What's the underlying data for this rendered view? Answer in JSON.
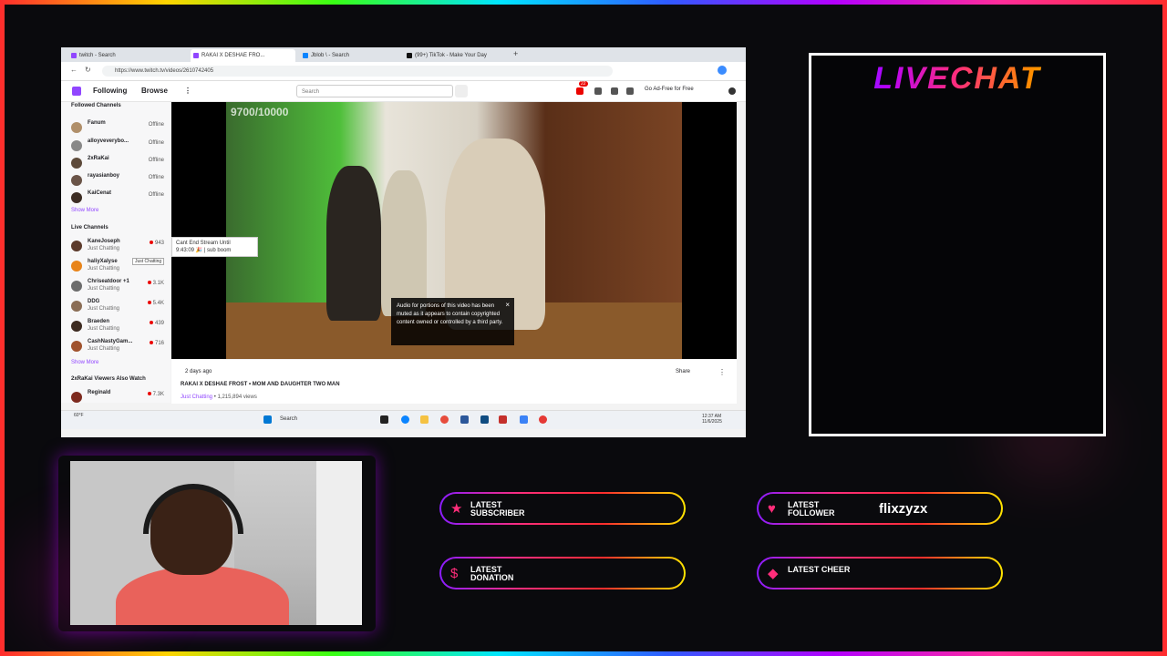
{
  "browser": {
    "tabs": [
      {
        "label": "twitch - Search"
      },
      {
        "label": "RAKAI X DESHAE FRO..."
      },
      {
        "label": "Jblob \\ - Search"
      },
      {
        "label": "(99+) TikTok - Make Your Day"
      }
    ],
    "url": "https://www.twitch.tv/videos/2610742405"
  },
  "twitch": {
    "nav": {
      "following": "Following",
      "browse": "Browse"
    },
    "search_placeholder": "Search",
    "notif_count": "22",
    "ad_free": "Go Ad-Free for Free",
    "sidebar": {
      "followed_title": "Followed Channels",
      "followed": [
        {
          "name": "Fanum",
          "status": "Offline"
        },
        {
          "name": "alloyveverybo...",
          "status": "Offline"
        },
        {
          "name": "2xRaKai",
          "status": "Offline"
        },
        {
          "name": "rayasianboy",
          "status": "Offline"
        },
        {
          "name": "KaiCenat",
          "status": "Offline"
        }
      ],
      "show_more": "Show More",
      "live_title": "Live Channels",
      "live": [
        {
          "name": "KaneJoseph",
          "category": "Just Chatting",
          "viewers": "943"
        },
        {
          "name": "haliyXalyse",
          "category": "Just Chatting",
          "viewers": ""
        },
        {
          "name": "Chriseatdoor +1",
          "category": "Just Chatting",
          "viewers": "3.1K"
        },
        {
          "name": "DDG",
          "category": "Just Chatting",
          "viewers": "5.4K"
        },
        {
          "name": "Braeden",
          "category": "Just Chatting",
          "viewers": "439"
        },
        {
          "name": "CashNastyGam...",
          "category": "Just Chatting",
          "viewers": "716"
        }
      ],
      "also_watch_title": "2xRaKai Viewers Also Watch",
      "also_watch": [
        {
          "name": "Reginald",
          "viewers": "7.3K"
        }
      ],
      "hover_tooltip": "Just Chatting"
    },
    "player": {
      "counter": "9700/10000",
      "mute_notice": "Audio for portions of this video has been muted as it appears to contain copyrighted content owned or controlled by a third party.",
      "tooltip_line1": "Cant End Stream Until",
      "tooltip_line2": "9:43:09 🎉 | sub boom"
    },
    "video": {
      "ago": "2 days ago",
      "title": "RAKAI X DESHAE FROST • MOM AND DAUGHTER TWO MAN",
      "category": "Just Chatting",
      "views": "• 1,215,894 views",
      "share": "Share"
    }
  },
  "taskbar": {
    "search": "Search",
    "weather": "60°F",
    "time": "12:37 AM",
    "date": "11/6/2025"
  },
  "overlay": {
    "livechat_title": "LIVECHAT",
    "alerts": {
      "subscriber": {
        "label": "LATEST SUBSCRIBER",
        "value": ""
      },
      "follower": {
        "label": "LATEST FOLLOWER",
        "value": "flixzyzx"
      },
      "donation": {
        "label": "LATEST DONATION",
        "value": ""
      },
      "cheer": {
        "label": "LATEST CHEER",
        "value": ""
      }
    }
  },
  "colors": {
    "twitch_purple": "#9146ff",
    "live_red": "#eb0400",
    "alert_pink": "#ff2d7a"
  }
}
